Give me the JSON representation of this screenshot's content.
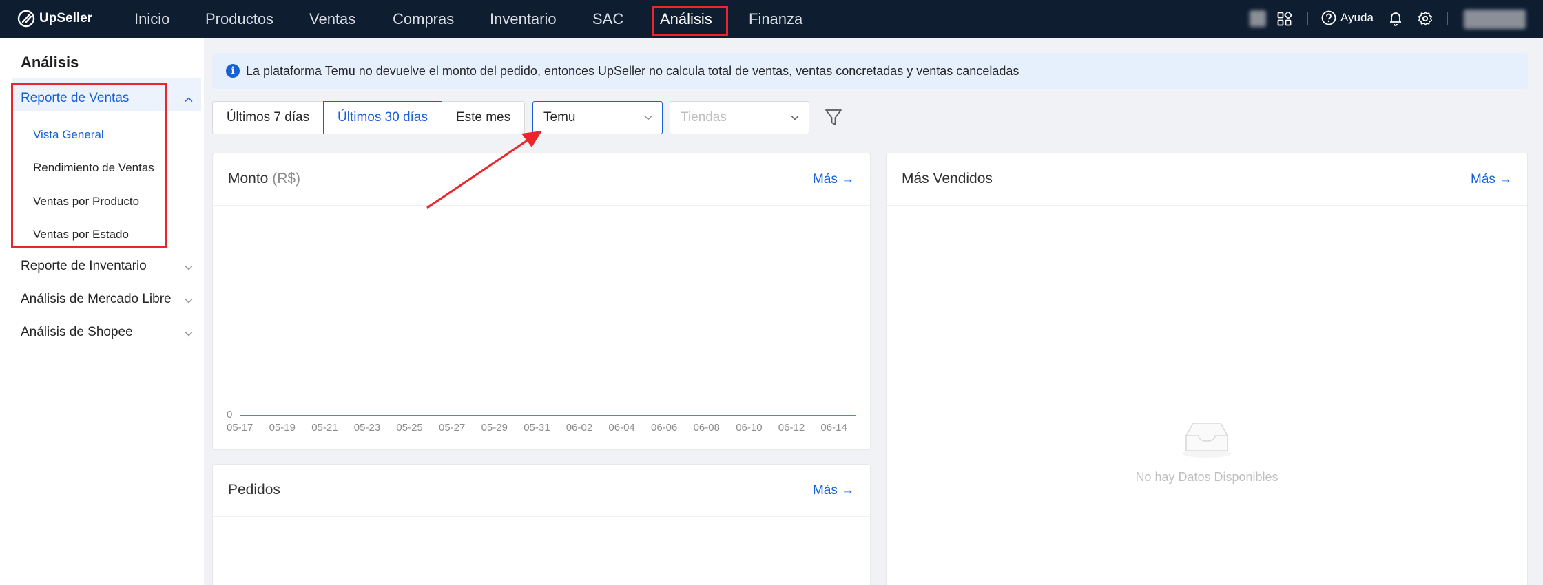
{
  "app": {
    "brand": "UpSeller"
  },
  "topnav": {
    "items": [
      {
        "label": "Inicio"
      },
      {
        "label": "Productos"
      },
      {
        "label": "Ventas"
      },
      {
        "label": "Compras"
      },
      {
        "label": "Inventario"
      },
      {
        "label": "SAC"
      },
      {
        "label": "Análisis"
      },
      {
        "label": "Finanza"
      }
    ],
    "active": "Análisis",
    "help_label": "Ayuda"
  },
  "sidebar": {
    "title": "Análisis",
    "groups": [
      {
        "label": "Reporte de Ventas",
        "expanded": true,
        "items": [
          {
            "label": "Vista General",
            "selected": true
          },
          {
            "label": "Rendimiento de Ventas"
          },
          {
            "label": "Ventas por Producto"
          },
          {
            "label": "Ventas por Estado"
          }
        ]
      },
      {
        "label": "Reporte de Inventario",
        "expanded": false
      },
      {
        "label": "Análisis de Mercado Libre",
        "expanded": false
      },
      {
        "label": "Análisis de Shopee",
        "expanded": false
      }
    ]
  },
  "banner": {
    "text": "La plataforma Temu no devuelve el monto del pedido, entonces UpSeller no calcula total de ventas, ventas concretadas y ventas canceladas"
  },
  "filters": {
    "date_ranges": [
      {
        "label": "Últimos 7 días"
      },
      {
        "label": "Últimos 30 días",
        "active": true
      },
      {
        "label": "Este mes"
      }
    ],
    "platform_value": "Temu",
    "stores_placeholder": "Tiendas"
  },
  "cards": {
    "amount": {
      "title": "Monto",
      "unit": "(R$)",
      "more_label": "Más"
    },
    "best_sellers": {
      "title": "Más Vendidos",
      "more_label": "Más",
      "empty_text": "No hay Datos Disponibles"
    },
    "orders": {
      "title": "Pedidos",
      "more_label": "Más"
    }
  },
  "chart_data": {
    "type": "line",
    "title": "Monto (R$)",
    "x": [
      "05-17",
      "05-19",
      "05-21",
      "05-23",
      "05-25",
      "05-27",
      "05-29",
      "05-31",
      "06-02",
      "06-04",
      "06-06",
      "06-08",
      "06-10",
      "06-12",
      "06-14"
    ],
    "y_ticks": [
      "0"
    ],
    "series": [
      {
        "values": [
          0,
          0,
          0,
          0,
          0,
          0,
          0,
          0,
          0,
          0,
          0,
          0,
          0,
          0,
          0
        ]
      }
    ],
    "colors": {
      "line": "#4f7ff0"
    }
  },
  "colors": {
    "topbar": "#0f1d31",
    "accent": "#1660d9",
    "highlight": "#e8262b"
  }
}
